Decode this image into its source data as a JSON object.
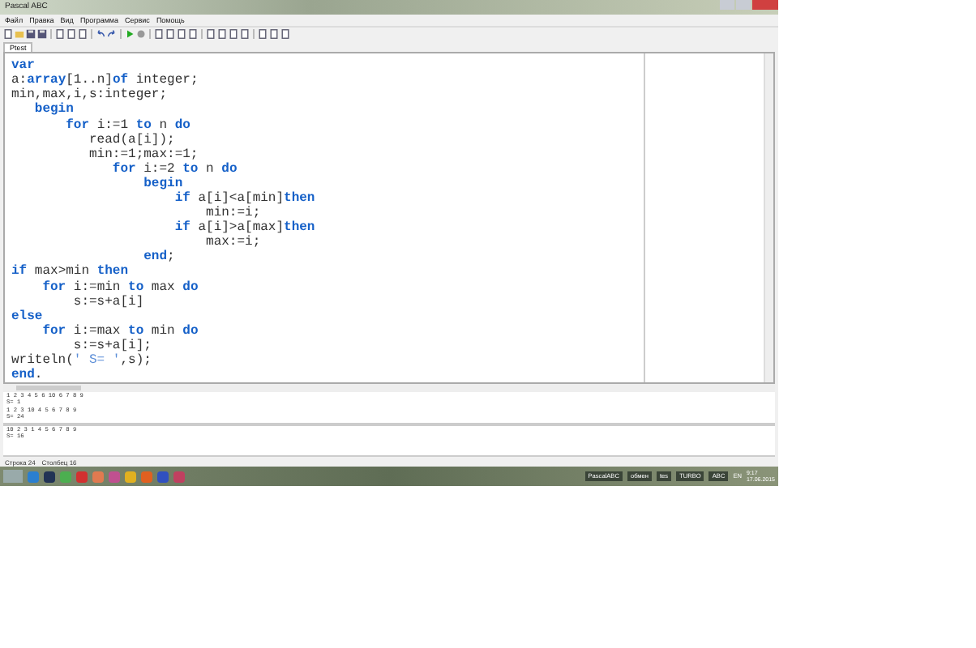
{
  "window": {
    "title": "Pascal ABC"
  },
  "menu": [
    "Файл",
    "Правка",
    "Вид",
    "Программа",
    "Сервис",
    "Помощь"
  ],
  "tabs": [
    {
      "label": "Ptest",
      "selected": true
    }
  ],
  "code": [
    [
      {
        "kind": "kw",
        "t": "var"
      }
    ],
    [
      {
        "kind": "plain",
        "t": "a:"
      },
      {
        "kind": "kw",
        "t": "array"
      },
      {
        "kind": "plain",
        "t": "[1..n]"
      },
      {
        "kind": "kw",
        "t": "of"
      },
      {
        "kind": "plain",
        "t": " integer;"
      }
    ],
    [
      {
        "kind": "plain",
        "t": "min,max,i,s:integer;"
      }
    ],
    [
      {
        "kind": "kw",
        "t": "   begin"
      }
    ],
    [
      {
        "kind": "kw",
        "t": "       for"
      },
      {
        "kind": "plain",
        "t": " i:=1 "
      },
      {
        "kind": "kw",
        "t": "to"
      },
      {
        "kind": "plain",
        "t": " n "
      },
      {
        "kind": "kw",
        "t": "do"
      }
    ],
    [
      {
        "kind": "plain",
        "t": "          read(a[i]);"
      }
    ],
    [
      {
        "kind": "plain",
        "t": "          min:=1;max:=1;"
      }
    ],
    [
      {
        "kind": "kw",
        "t": "             for"
      },
      {
        "kind": "plain",
        "t": " i:=2 "
      },
      {
        "kind": "kw",
        "t": "to"
      },
      {
        "kind": "plain",
        "t": " n "
      },
      {
        "kind": "kw",
        "t": "do"
      }
    ],
    [
      {
        "kind": "kw",
        "t": "                 begin"
      }
    ],
    [
      {
        "kind": "kw",
        "t": "                     if"
      },
      {
        "kind": "plain",
        "t": " a[i]<a[min]"
      },
      {
        "kind": "kw",
        "t": "then"
      }
    ],
    [
      {
        "kind": "plain",
        "t": "                         min:=i;"
      }
    ],
    [
      {
        "kind": "kw",
        "t": "                     if"
      },
      {
        "kind": "plain",
        "t": " a[i]>a[max]"
      },
      {
        "kind": "kw",
        "t": "then"
      }
    ],
    [
      {
        "kind": "plain",
        "t": "                         max:=i;"
      }
    ],
    [
      {
        "kind": "kw",
        "t": "                 end"
      },
      {
        "kind": "plain",
        "t": ";"
      }
    ],
    [
      {
        "kind": "kw",
        "t": "if"
      },
      {
        "kind": "plain",
        "t": " max>min "
      },
      {
        "kind": "kw",
        "t": "then"
      }
    ],
    [
      {
        "kind": "kw",
        "t": "    for"
      },
      {
        "kind": "plain",
        "t": " i:=min "
      },
      {
        "kind": "kw",
        "t": "to"
      },
      {
        "kind": "plain",
        "t": " max "
      },
      {
        "kind": "kw",
        "t": "do"
      }
    ],
    [
      {
        "kind": "plain",
        "t": "        s:=s+a[i]"
      }
    ],
    [
      {
        "kind": "kw",
        "t": "else"
      }
    ],
    [
      {
        "kind": "kw",
        "t": "    for"
      },
      {
        "kind": "plain",
        "t": " i:=max "
      },
      {
        "kind": "kw",
        "t": "to"
      },
      {
        "kind": "plain",
        "t": " min "
      },
      {
        "kind": "kw",
        "t": "do"
      }
    ],
    [
      {
        "kind": "plain",
        "t": "        s:=s+a[i];"
      }
    ],
    [
      {
        "kind": "plain",
        "t": "writeln("
      },
      {
        "kind": "str",
        "t": "' S= '"
      },
      {
        "kind": "plain",
        "t": ",s);"
      }
    ],
    [
      {
        "kind": "kw",
        "t": "end"
      },
      {
        "kind": "plain",
        "t": "."
      }
    ]
  ],
  "output_top": [
    "1 2 3 4 5 6 10 6 7 8 9",
    " S= 1",
    "1 2 3 10 4 5 6 7 8 9",
    " S= 24"
  ],
  "output_bottom": [
    "10 2 3 1 4 5 6 7 8 9",
    " S= 16"
  ],
  "status_bar": [
    "Строка 24",
    "Столбец 16"
  ],
  "taskbar": {
    "windows": [
      "PascalABC",
      "обмен",
      "tes",
      "TURBO",
      "ABC"
    ],
    "language": "EN",
    "time": "9:17",
    "date": "17.06.2015"
  }
}
